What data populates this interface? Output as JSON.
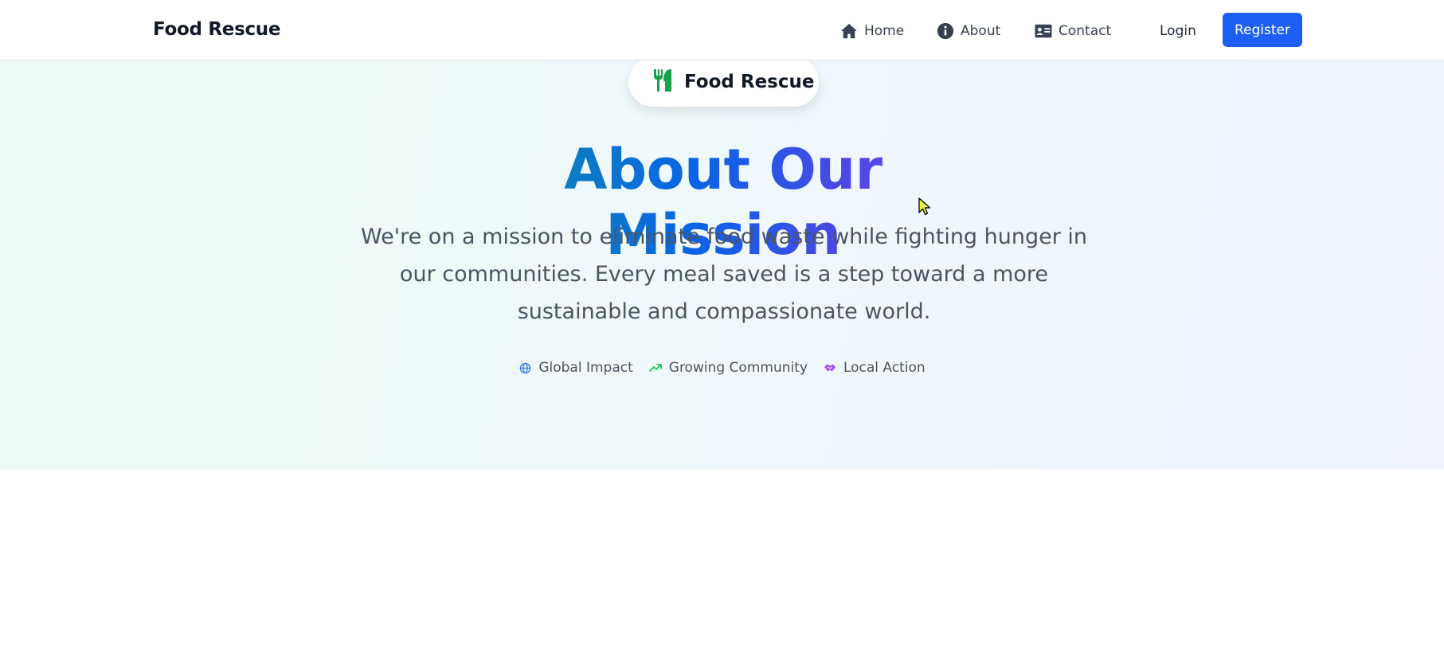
{
  "navbar": {
    "brand": "Food Rescue",
    "links": [
      {
        "label": "Home",
        "icon": "home-icon"
      },
      {
        "label": "About",
        "icon": "info-icon"
      },
      {
        "label": "Contact",
        "icon": "contact-card-icon"
      }
    ],
    "login_label": "Login",
    "register_label": "Register"
  },
  "hero": {
    "pill_label": "Food Rescue",
    "pill_icon": "utensils-icon",
    "title": "About Our Mission",
    "description": "We're on a mission to eliminate food waste while fighting hunger in our communities. Every meal saved is a step toward a more sustainable and compassionate world.",
    "tags": [
      {
        "label": "Global Impact",
        "icon": "globe-icon",
        "color": "#3b82f6"
      },
      {
        "label": "Growing Community",
        "icon": "trending-up-icon",
        "color": "#22c55e"
      },
      {
        "label": "Local Action",
        "icon": "handshake-icon",
        "color": "#a855f7"
      }
    ]
  },
  "colors": {
    "accent": "#1d5ff5",
    "title_gradient_start": "#0e8fa8",
    "title_gradient_end": "#6d4ff0",
    "pill_icon": "#16a34a"
  }
}
